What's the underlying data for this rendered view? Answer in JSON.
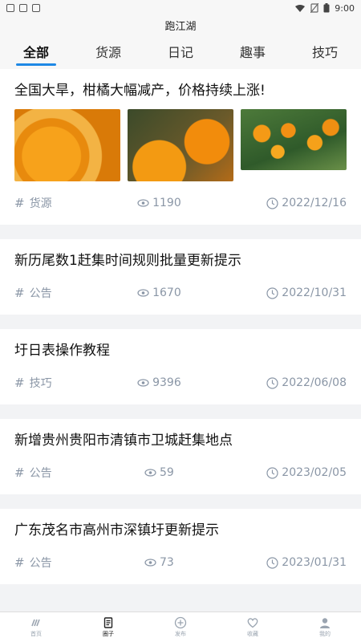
{
  "status": {
    "time": "9:00"
  },
  "app": {
    "title": "跑江湖"
  },
  "tabs": [
    {
      "label": "全部",
      "active": true
    },
    {
      "label": "货源"
    },
    {
      "label": "日记"
    },
    {
      "label": "趣事"
    },
    {
      "label": "技巧"
    }
  ],
  "posts": [
    {
      "title": "全国大旱，柑橘大幅减产，价格持续上涨!",
      "tag": "货源",
      "views": "1190",
      "date": "2022/12/16",
      "has_images": true
    },
    {
      "title": "新历尾数1赶集时间规则批量更新提示",
      "tag": "公告",
      "views": "1670",
      "date": "2022/10/31"
    },
    {
      "title": "圩日表操作教程",
      "tag": "技巧",
      "views": "9396",
      "date": "2022/06/08"
    },
    {
      "title": "新增贵州贵阳市清镇市卫城赶集地点",
      "tag": "公告",
      "views": "59",
      "date": "2023/02/05"
    },
    {
      "title": "广东茂名市高州市深镇圩更新提示",
      "tag": "公告",
      "views": "73",
      "date": "2023/01/31"
    }
  ],
  "nav": [
    {
      "label": "首页",
      "icon": "home-icon"
    },
    {
      "label": "圈子",
      "icon": "circle-doc-icon",
      "active": true
    },
    {
      "label": "发布",
      "icon": "plus-circle-icon"
    },
    {
      "label": "收藏",
      "icon": "heart-icon"
    },
    {
      "label": "我的",
      "icon": "user-icon"
    }
  ],
  "colors": {
    "accent": "#1e88e5",
    "meta": "#8a96a6"
  }
}
